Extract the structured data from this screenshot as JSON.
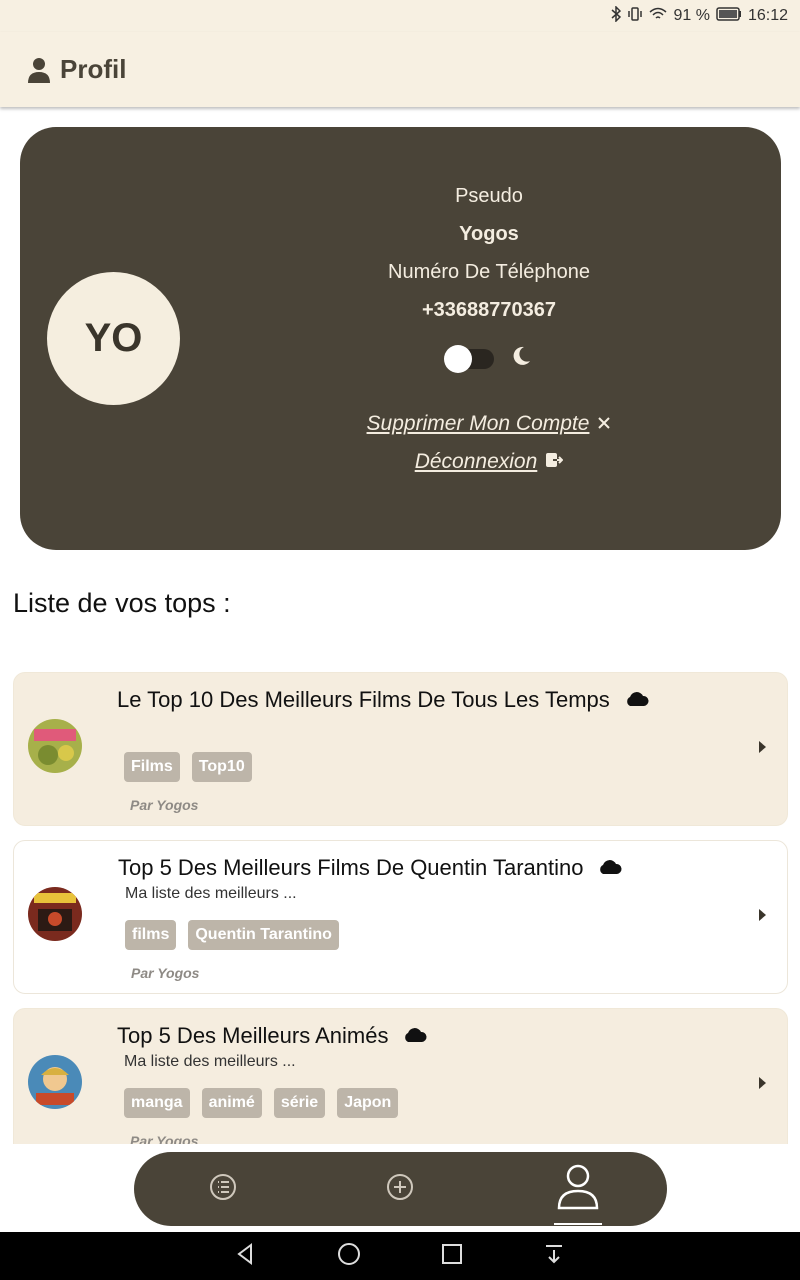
{
  "status": {
    "battery": "91 %",
    "time": "16:12"
  },
  "header": {
    "title": "Profil",
    "icon": "person-icon"
  },
  "profile": {
    "initials": "YO",
    "pseudo_label": "Pseudo",
    "pseudo_value": "Yogos",
    "phone_label": "Numéro De Téléphone",
    "phone_value": "+33688770367",
    "dark_mode": false,
    "delete_label": "Supprimer Mon Compte",
    "logout_label": "Déconnexion"
  },
  "list_title": "Liste de vos tops :",
  "tops": [
    {
      "title": "Le Top 10 Des Meilleurs Films De Tous Les Temps",
      "desc": "",
      "tags": [
        "Films",
        "Top10"
      ],
      "author": "Par Yogos",
      "thumb_color": "#a7b04a"
    },
    {
      "title": "Top 5 Des Meilleurs Films De Quentin Tarantino",
      "desc": "Ma liste des meilleurs ...",
      "tags": [
        "films",
        "Quentin Tarantino"
      ],
      "author": "Par Yogos",
      "thumb_color": "#7a2a1e"
    },
    {
      "title": "Top 5 Des Meilleurs Animés",
      "desc": "Ma liste des meilleurs ...",
      "tags": [
        "manga",
        "animé",
        "série",
        "Japon"
      ],
      "author": "Par Yogos",
      "thumb_color": "#4a8ab8"
    }
  ],
  "colors": {
    "card_dark": "#4a4438",
    "beige": "#f5eddf",
    "tag": "#bdb5a9"
  }
}
